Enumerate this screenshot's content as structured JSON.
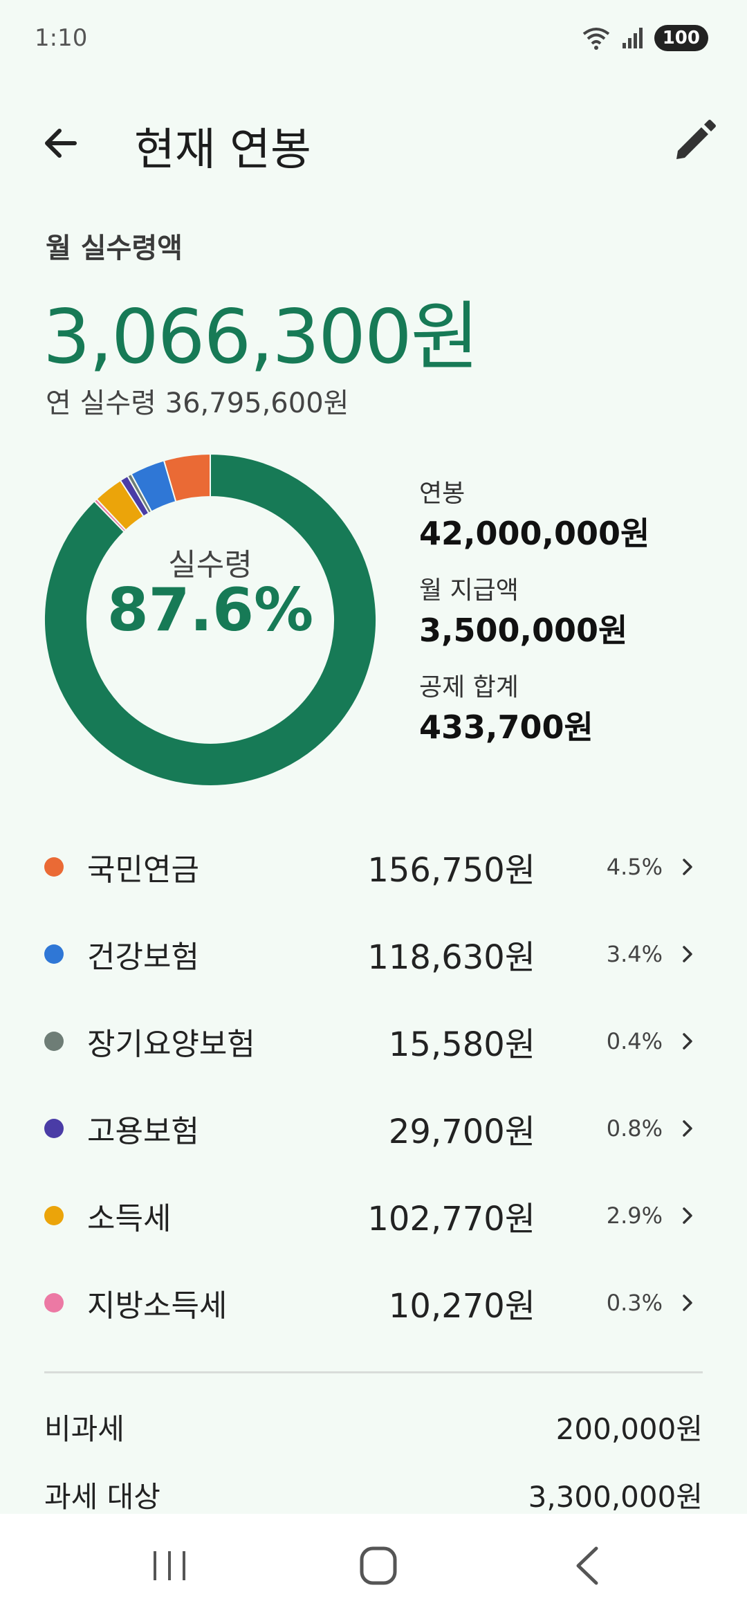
{
  "status": {
    "time": "1:10",
    "battery": "100"
  },
  "header": {
    "title": "현재 연봉"
  },
  "monthly": {
    "label": "월 실수령액",
    "amount": "3,066,300원",
    "annual_net": "연 실수령 36,795,600원"
  },
  "chart": {
    "center_label": "실수령",
    "center_pct": "87.6%"
  },
  "summary": {
    "items": [
      {
        "label": "연봉",
        "value": "42,000,000원"
      },
      {
        "label": "월 지급액",
        "value": "3,500,000원"
      },
      {
        "label": "공제 합계",
        "value": "433,700원"
      }
    ]
  },
  "deductions": [
    {
      "name": "국민연금",
      "amount": "156,750원",
      "pct": "4.5%",
      "color": "#ea6a35"
    },
    {
      "name": "건강보험",
      "amount": "118,630원",
      "pct": "3.4%",
      "color": "#2f77d6"
    },
    {
      "name": "장기요양보험",
      "amount": "15,580원",
      "pct": "0.4%",
      "color": "#6e7d76"
    },
    {
      "name": "고용보험",
      "amount": "29,700원",
      "pct": "0.8%",
      "color": "#4a3ca6"
    },
    {
      "name": "소득세",
      "amount": "102,770원",
      "pct": "2.9%",
      "color": "#eba40a"
    },
    {
      "name": "지방소득세",
      "amount": "10,270원",
      "pct": "0.3%",
      "color": "#ec79a4"
    }
  ],
  "tax": {
    "nontaxable_label": "비과세",
    "nontaxable_value": "200,000원",
    "taxable_label": "과세 대상",
    "taxable_value": "3,300,000원"
  },
  "chart_data": {
    "type": "pie",
    "categories": [
      "실수령",
      "국민연금",
      "건강보험",
      "장기요양보험",
      "고용보험",
      "소득세",
      "지방소득세"
    ],
    "values": [
      87.6,
      4.5,
      3.4,
      0.4,
      0.8,
      2.9,
      0.3
    ],
    "colors": [
      "#177a56",
      "#ea6a35",
      "#2f77d6",
      "#6e7d76",
      "#4a3ca6",
      "#eba40a",
      "#ec79a4"
    ]
  },
  "colors": {
    "accent": "#177a56",
    "background": "#f3faf5"
  },
  "icons": {
    "back": "arrow-left-icon",
    "edit": "pencil-icon",
    "chevron": "chevron-right-icon"
  }
}
